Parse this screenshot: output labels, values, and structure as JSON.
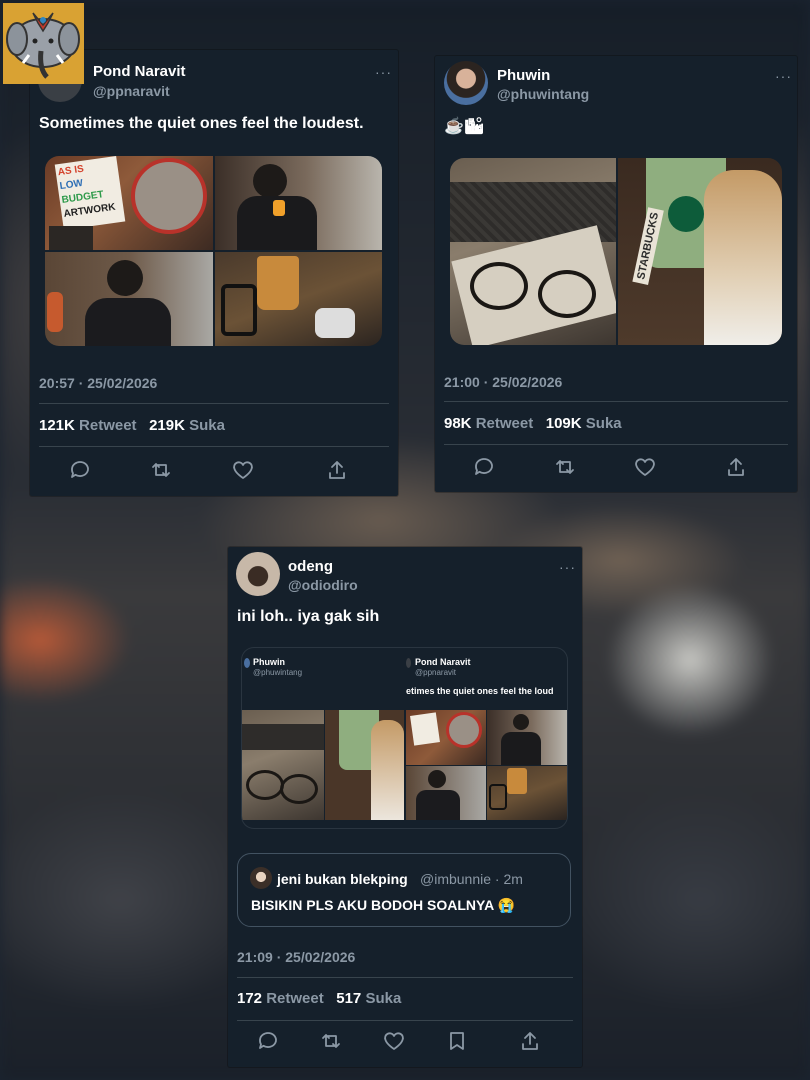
{
  "tweet1": {
    "name": "Pond Naravit",
    "handle": "@ppnaravit",
    "text": "Sometimes the quiet ones feel the loudest.",
    "time": "20:57 · 25/02/2026",
    "retweets": "121K",
    "retweet_label": "Retweet",
    "likes": "219K",
    "like_label": "Suka",
    "more": "···",
    "poster_text": [
      "AS IS",
      "LOW",
      "BUDGET",
      "ARTWORK"
    ]
  },
  "tweet2": {
    "name": "Phuwin",
    "handle": "@phuwintang",
    "text": "☕🏙",
    "time": "21:00 · 25/02/2026",
    "retweets": "98K",
    "retweet_label": "Retweet",
    "likes": "109K",
    "like_label": "Suka",
    "more": "···",
    "cup_text": "STARBUCKS"
  },
  "tweet3": {
    "name": "odeng",
    "handle": "@odiodiro",
    "text": "ini loh.. iya gak sih",
    "time": "21:09 · 25/02/2026",
    "retweets": "172",
    "retweet_label": "Retweet",
    "likes": "517",
    "like_label": "Suka",
    "more": "···",
    "embed_left": {
      "name": "Phuwin",
      "handle": "@phuwintang"
    },
    "embed_right": {
      "name": "Pond Naravit",
      "handle": "@ppnaravit",
      "text": "etimes the quiet ones feel the loud"
    },
    "reply": {
      "name": "jeni bukan blekping",
      "meta": "@imbunnie · 2m",
      "text": "BISIKIN PLS AKU BODOH SOALNYA 😭"
    }
  },
  "colors": {
    "card_bg": "#15202b",
    "muted": "#8b98a5",
    "divider": "#38444d"
  }
}
